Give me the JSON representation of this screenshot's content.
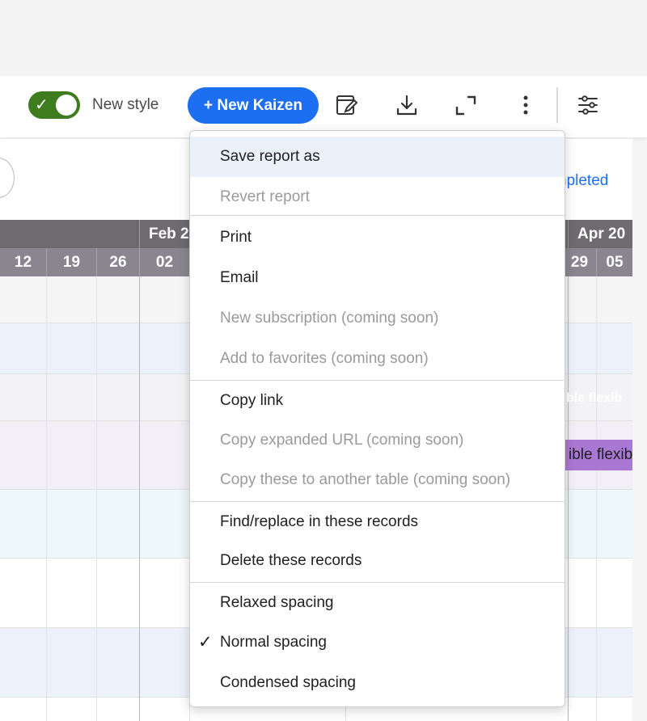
{
  "toolbar": {
    "toggle": {
      "label": "New style",
      "on": true
    },
    "new_kaizen_label": "+ New Kaizen",
    "icons": [
      "edit-report-icon",
      "download-icon",
      "expand-icon",
      "more-vertical-icon",
      "settings-sliders-icon"
    ]
  },
  "table": {
    "months": [
      "Feb 2",
      "Apr 20"
    ],
    "weeks": [
      "12",
      "19",
      "26",
      "02",
      "29",
      "05"
    ],
    "completed_text": "npleted",
    "ghost_text": "ble flexib",
    "bar_text": "ible flexib",
    "bar_color": "#a978d2"
  },
  "menu": {
    "items": [
      {
        "label": "Save report as",
        "enabled": true
      },
      {
        "label": "Revert report",
        "enabled": false
      },
      {
        "label": "Print",
        "enabled": true
      },
      {
        "label": "Email",
        "enabled": true
      },
      {
        "label": "New subscription (coming soon)",
        "enabled": false
      },
      {
        "label": "Add to favorites (coming soon)",
        "enabled": false
      },
      {
        "label": "Copy link",
        "enabled": true
      },
      {
        "label": "Copy expanded URL (coming soon)",
        "enabled": false
      },
      {
        "label": "Copy these to another table (coming soon)",
        "enabled": false
      },
      {
        "label": "Find/replace in these records",
        "enabled": true
      },
      {
        "label": "Delete these records",
        "enabled": true
      },
      {
        "label": "Relaxed spacing",
        "enabled": true
      },
      {
        "label": "Normal spacing",
        "enabled": true,
        "checked": true
      },
      {
        "label": "Condensed spacing",
        "enabled": true
      }
    ]
  },
  "colors": {
    "accent": "#1d6ff2",
    "toggle_on": "#3f7b1f",
    "header_dark": "#6d6a70",
    "header_light": "#8a8690"
  }
}
